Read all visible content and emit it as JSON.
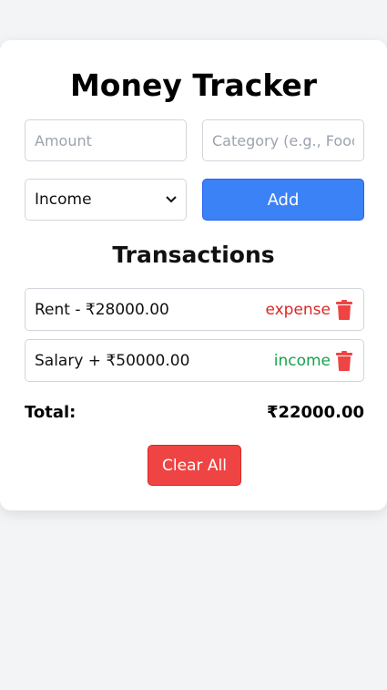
{
  "app": {
    "title": "Money Tracker"
  },
  "form": {
    "amount_placeholder": "Amount",
    "category_placeholder": "Category (e.g., Food)",
    "type_selected": "Income",
    "add_label": "Add"
  },
  "transactions": {
    "heading": "Transactions",
    "items": [
      {
        "text": "Rent - ₹28000.00",
        "type": "expense",
        "type_color": "#dc2626"
      },
      {
        "text": "Salary + ₹50000.00",
        "type": "income",
        "type_color": "#16a34a"
      }
    ]
  },
  "summary": {
    "total_label": "Total:",
    "total_value": "₹22000.00"
  },
  "actions": {
    "clear_label": "Clear All"
  },
  "colors": {
    "accent_blue": "#3b82f6",
    "danger_red": "#ef4444",
    "trash_icon": "#ef4444"
  }
}
